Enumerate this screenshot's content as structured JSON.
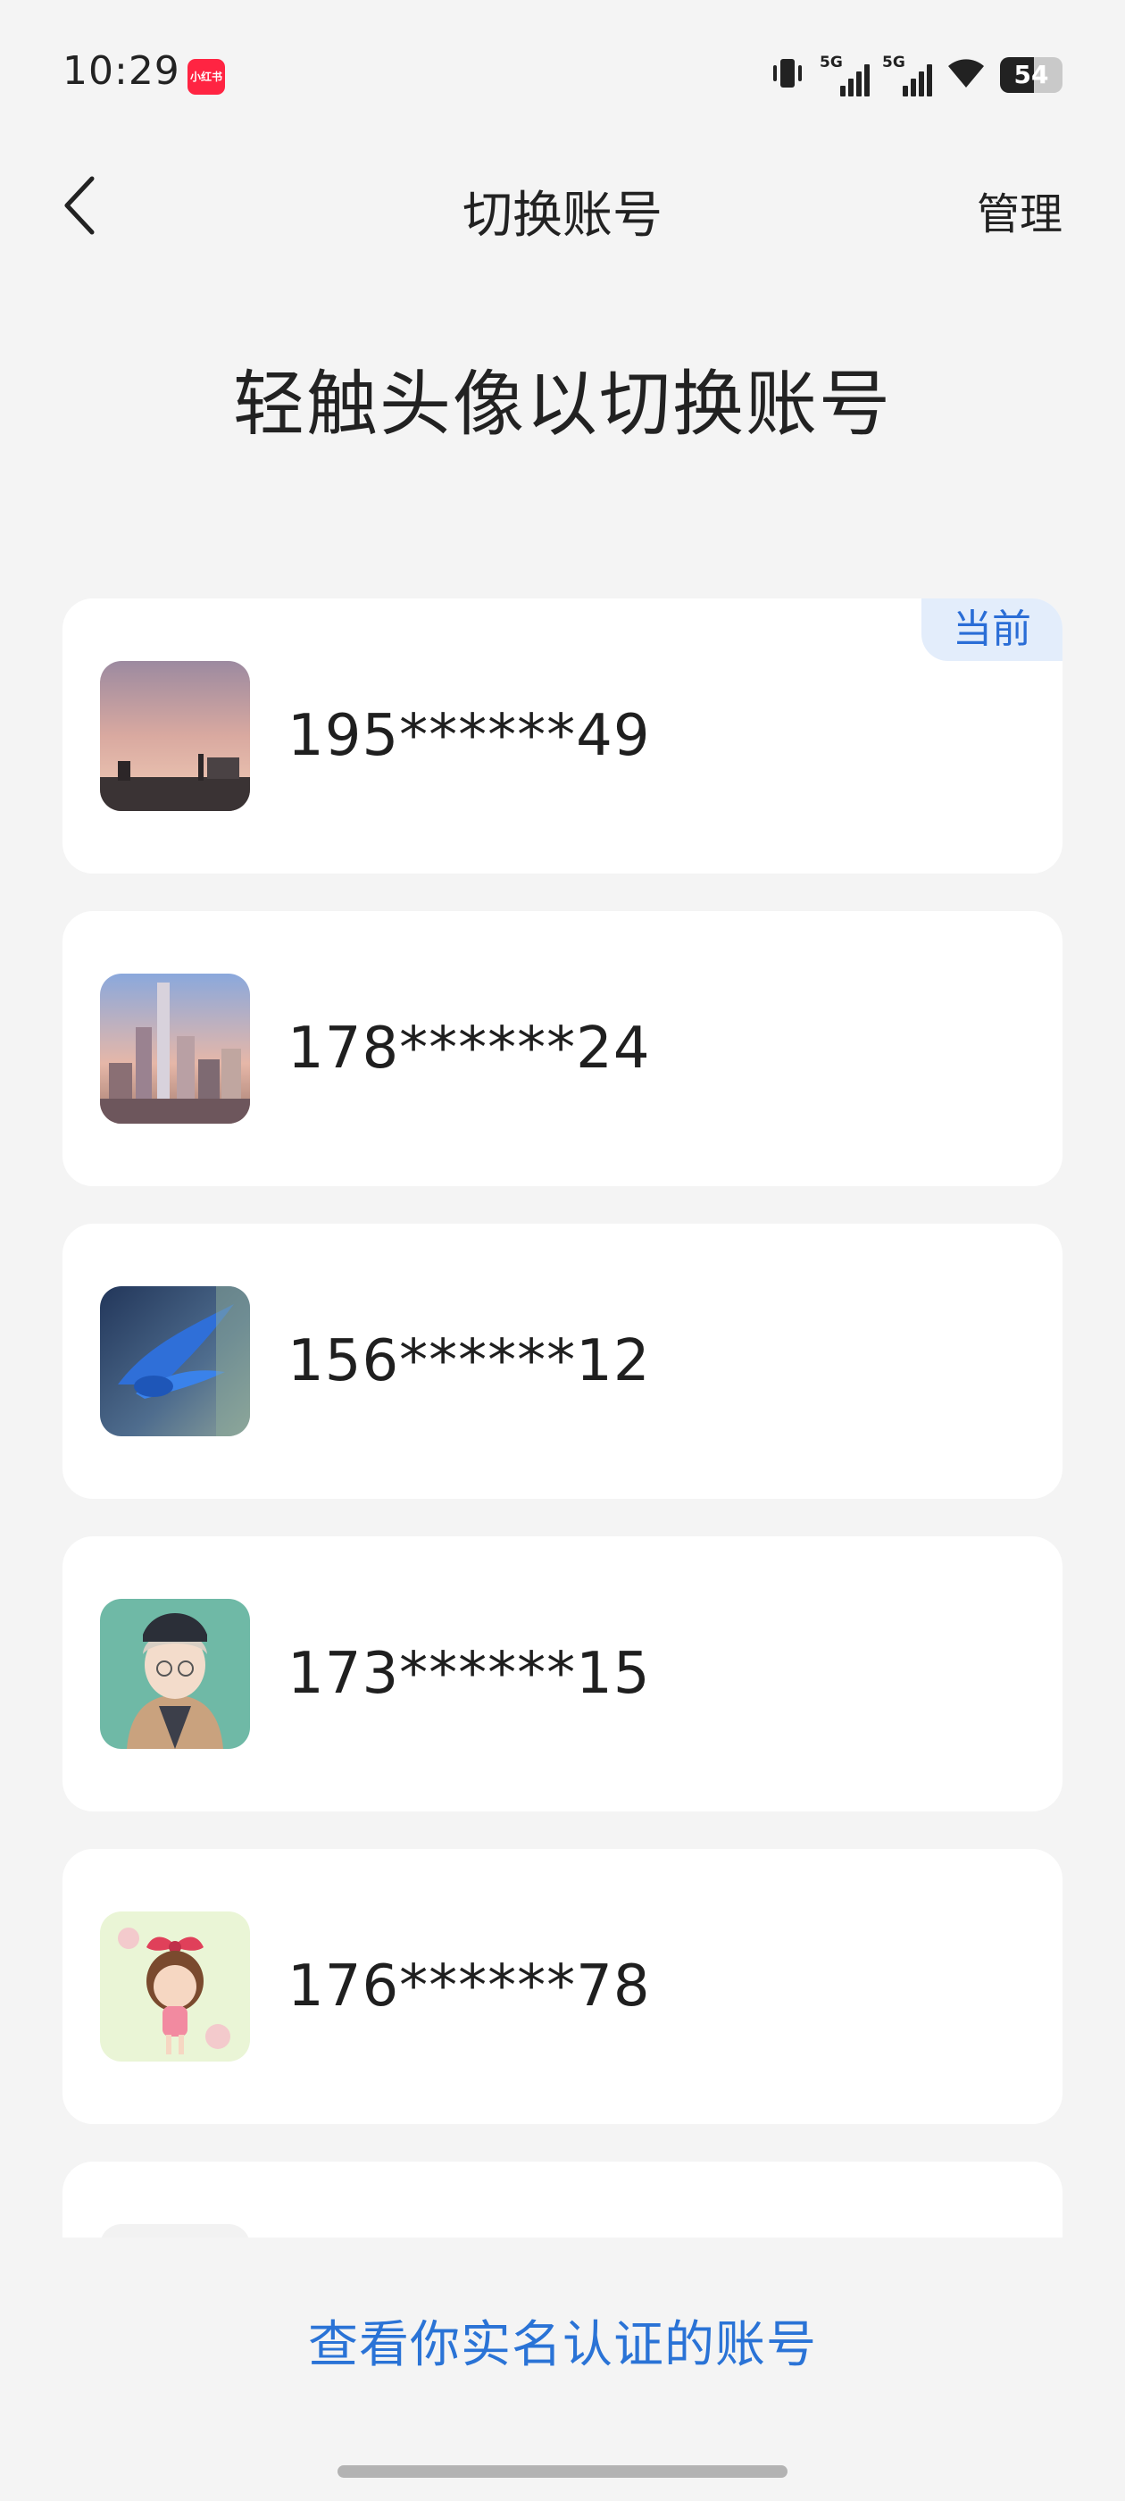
{
  "status_bar": {
    "time": "10:29",
    "app_badge": "小红书",
    "signal_1_tag": "5G",
    "signal_2_tag": "5G",
    "battery": "54",
    "battery_level": 0.54
  },
  "nav": {
    "title": "切换账号",
    "manage_label": "管理"
  },
  "headline": "轻触头像以切换账号",
  "accounts": [
    {
      "number": "195******49",
      "current_badge": "当前",
      "avatar": "sunset-skyline-photo"
    },
    {
      "number": "178******24",
      "avatar": "city-skyscrapers-photo"
    },
    {
      "number": "156******12",
      "avatar": "blue-bird-photo"
    },
    {
      "number": "173******15",
      "avatar": "anime-boy-illustration"
    },
    {
      "number": "176******78",
      "avatar": "cartoon-girl-illustration"
    },
    {
      "number": "",
      "avatar": "partially-hidden"
    }
  ],
  "footer": {
    "verify_link": "查看你实名认证的账号"
  },
  "colors": {
    "accent": "#2a73d6",
    "badge_bg": "#e3edfb",
    "page_bg": "#f4f4f4",
    "card_bg": "#ffffff"
  }
}
